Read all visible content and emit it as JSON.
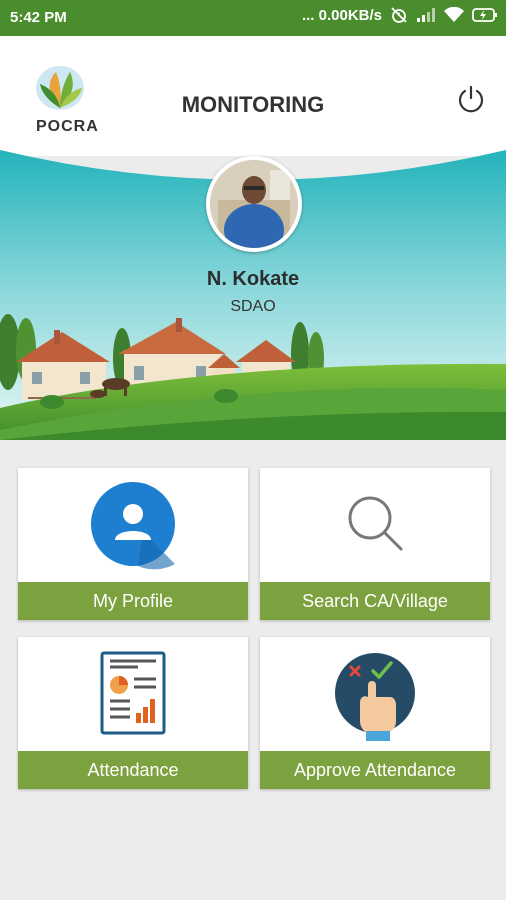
{
  "status_bar": {
    "time": "5:42 PM",
    "network_speed": "... 0.00KB/s",
    "icons": [
      "alarm-off-icon",
      "signal-icon",
      "wifi-icon",
      "battery-charging-icon"
    ]
  },
  "header": {
    "logo_text": "POCRA",
    "title": "MONITORING",
    "power_icon": "power-icon"
  },
  "user": {
    "name": "N. Kokate",
    "role": "SDAO"
  },
  "tiles": [
    {
      "label": "My Profile",
      "icon": "user-profile-icon"
    },
    {
      "label": "Search CA/Village",
      "icon": "magnifier-icon"
    },
    {
      "label": "Attendance",
      "icon": "report-chart-icon"
    },
    {
      "label": "Approve Attendance",
      "icon": "approve-hand-icon"
    }
  ],
  "colors": {
    "status_bar": "#4a8d2d",
    "tile_label_bg": "#7ba23f",
    "page_bg": "#ececec",
    "sky": "#2bb5bd",
    "profile_circle": "#1e7fd0"
  }
}
